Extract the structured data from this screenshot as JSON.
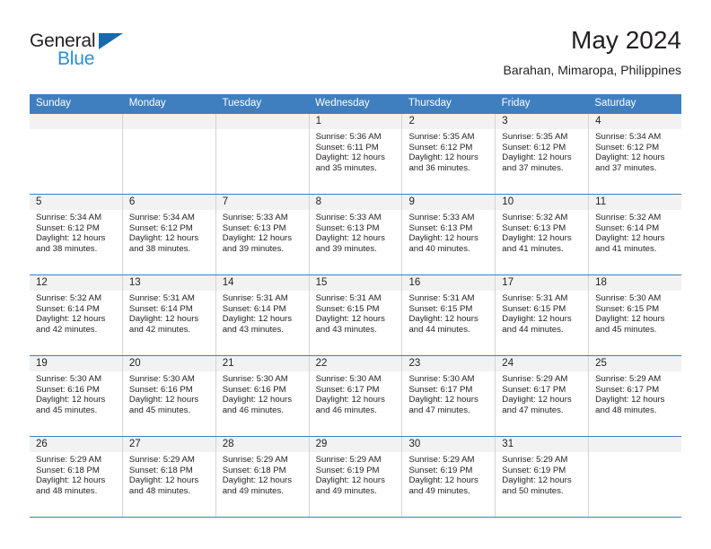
{
  "brand": {
    "line1": "General",
    "line2": "Blue",
    "triangle_color": "#1769b0",
    "line2_color": "#2a8ed6"
  },
  "header": {
    "title": "May 2024",
    "subtitle": "Barahan, Mimaropa, Philippines"
  },
  "theme": {
    "header_blue": "#3f7fbf",
    "cell_band_gray": "#f2f2f2",
    "grid_line": "#d4d4d4",
    "text": "#231f20"
  },
  "weekdays": [
    "Sunday",
    "Monday",
    "Tuesday",
    "Wednesday",
    "Thursday",
    "Friday",
    "Saturday"
  ],
  "weeks": [
    [
      {
        "day": "",
        "sunrise": "",
        "sunset": "",
        "daylight1": "",
        "daylight2": ""
      },
      {
        "day": "",
        "sunrise": "",
        "sunset": "",
        "daylight1": "",
        "daylight2": ""
      },
      {
        "day": "",
        "sunrise": "",
        "sunset": "",
        "daylight1": "",
        "daylight2": ""
      },
      {
        "day": "1",
        "sunrise": "Sunrise: 5:36 AM",
        "sunset": "Sunset: 6:11 PM",
        "daylight1": "Daylight: 12 hours",
        "daylight2": "and 35 minutes."
      },
      {
        "day": "2",
        "sunrise": "Sunrise: 5:35 AM",
        "sunset": "Sunset: 6:12 PM",
        "daylight1": "Daylight: 12 hours",
        "daylight2": "and 36 minutes."
      },
      {
        "day": "3",
        "sunrise": "Sunrise: 5:35 AM",
        "sunset": "Sunset: 6:12 PM",
        "daylight1": "Daylight: 12 hours",
        "daylight2": "and 37 minutes."
      },
      {
        "day": "4",
        "sunrise": "Sunrise: 5:34 AM",
        "sunset": "Sunset: 6:12 PM",
        "daylight1": "Daylight: 12 hours",
        "daylight2": "and 37 minutes."
      }
    ],
    [
      {
        "day": "5",
        "sunrise": "Sunrise: 5:34 AM",
        "sunset": "Sunset: 6:12 PM",
        "daylight1": "Daylight: 12 hours",
        "daylight2": "and 38 minutes."
      },
      {
        "day": "6",
        "sunrise": "Sunrise: 5:34 AM",
        "sunset": "Sunset: 6:12 PM",
        "daylight1": "Daylight: 12 hours",
        "daylight2": "and 38 minutes."
      },
      {
        "day": "7",
        "sunrise": "Sunrise: 5:33 AM",
        "sunset": "Sunset: 6:13 PM",
        "daylight1": "Daylight: 12 hours",
        "daylight2": "and 39 minutes."
      },
      {
        "day": "8",
        "sunrise": "Sunrise: 5:33 AM",
        "sunset": "Sunset: 6:13 PM",
        "daylight1": "Daylight: 12 hours",
        "daylight2": "and 39 minutes."
      },
      {
        "day": "9",
        "sunrise": "Sunrise: 5:33 AM",
        "sunset": "Sunset: 6:13 PM",
        "daylight1": "Daylight: 12 hours",
        "daylight2": "and 40 minutes."
      },
      {
        "day": "10",
        "sunrise": "Sunrise: 5:32 AM",
        "sunset": "Sunset: 6:13 PM",
        "daylight1": "Daylight: 12 hours",
        "daylight2": "and 41 minutes."
      },
      {
        "day": "11",
        "sunrise": "Sunrise: 5:32 AM",
        "sunset": "Sunset: 6:14 PM",
        "daylight1": "Daylight: 12 hours",
        "daylight2": "and 41 minutes."
      }
    ],
    [
      {
        "day": "12",
        "sunrise": "Sunrise: 5:32 AM",
        "sunset": "Sunset: 6:14 PM",
        "daylight1": "Daylight: 12 hours",
        "daylight2": "and 42 minutes."
      },
      {
        "day": "13",
        "sunrise": "Sunrise: 5:31 AM",
        "sunset": "Sunset: 6:14 PM",
        "daylight1": "Daylight: 12 hours",
        "daylight2": "and 42 minutes."
      },
      {
        "day": "14",
        "sunrise": "Sunrise: 5:31 AM",
        "sunset": "Sunset: 6:14 PM",
        "daylight1": "Daylight: 12 hours",
        "daylight2": "and 43 minutes."
      },
      {
        "day": "15",
        "sunrise": "Sunrise: 5:31 AM",
        "sunset": "Sunset: 6:15 PM",
        "daylight1": "Daylight: 12 hours",
        "daylight2": "and 43 minutes."
      },
      {
        "day": "16",
        "sunrise": "Sunrise: 5:31 AM",
        "sunset": "Sunset: 6:15 PM",
        "daylight1": "Daylight: 12 hours",
        "daylight2": "and 44 minutes."
      },
      {
        "day": "17",
        "sunrise": "Sunrise: 5:31 AM",
        "sunset": "Sunset: 6:15 PM",
        "daylight1": "Daylight: 12 hours",
        "daylight2": "and 44 minutes."
      },
      {
        "day": "18",
        "sunrise": "Sunrise: 5:30 AM",
        "sunset": "Sunset: 6:15 PM",
        "daylight1": "Daylight: 12 hours",
        "daylight2": "and 45 minutes."
      }
    ],
    [
      {
        "day": "19",
        "sunrise": "Sunrise: 5:30 AM",
        "sunset": "Sunset: 6:16 PM",
        "daylight1": "Daylight: 12 hours",
        "daylight2": "and 45 minutes."
      },
      {
        "day": "20",
        "sunrise": "Sunrise: 5:30 AM",
        "sunset": "Sunset: 6:16 PM",
        "daylight1": "Daylight: 12 hours",
        "daylight2": "and 45 minutes."
      },
      {
        "day": "21",
        "sunrise": "Sunrise: 5:30 AM",
        "sunset": "Sunset: 6:16 PM",
        "daylight1": "Daylight: 12 hours",
        "daylight2": "and 46 minutes."
      },
      {
        "day": "22",
        "sunrise": "Sunrise: 5:30 AM",
        "sunset": "Sunset: 6:17 PM",
        "daylight1": "Daylight: 12 hours",
        "daylight2": "and 46 minutes."
      },
      {
        "day": "23",
        "sunrise": "Sunrise: 5:30 AM",
        "sunset": "Sunset: 6:17 PM",
        "daylight1": "Daylight: 12 hours",
        "daylight2": "and 47 minutes."
      },
      {
        "day": "24",
        "sunrise": "Sunrise: 5:29 AM",
        "sunset": "Sunset: 6:17 PM",
        "daylight1": "Daylight: 12 hours",
        "daylight2": "and 47 minutes."
      },
      {
        "day": "25",
        "sunrise": "Sunrise: 5:29 AM",
        "sunset": "Sunset: 6:17 PM",
        "daylight1": "Daylight: 12 hours",
        "daylight2": "and 48 minutes."
      }
    ],
    [
      {
        "day": "26",
        "sunrise": "Sunrise: 5:29 AM",
        "sunset": "Sunset: 6:18 PM",
        "daylight1": "Daylight: 12 hours",
        "daylight2": "and 48 minutes."
      },
      {
        "day": "27",
        "sunrise": "Sunrise: 5:29 AM",
        "sunset": "Sunset: 6:18 PM",
        "daylight1": "Daylight: 12 hours",
        "daylight2": "and 48 minutes."
      },
      {
        "day": "28",
        "sunrise": "Sunrise: 5:29 AM",
        "sunset": "Sunset: 6:18 PM",
        "daylight1": "Daylight: 12 hours",
        "daylight2": "and 49 minutes."
      },
      {
        "day": "29",
        "sunrise": "Sunrise: 5:29 AM",
        "sunset": "Sunset: 6:19 PM",
        "daylight1": "Daylight: 12 hours",
        "daylight2": "and 49 minutes."
      },
      {
        "day": "30",
        "sunrise": "Sunrise: 5:29 AM",
        "sunset": "Sunset: 6:19 PM",
        "daylight1": "Daylight: 12 hours",
        "daylight2": "and 49 minutes."
      },
      {
        "day": "31",
        "sunrise": "Sunrise: 5:29 AM",
        "sunset": "Sunset: 6:19 PM",
        "daylight1": "Daylight: 12 hours",
        "daylight2": "and 50 minutes."
      },
      {
        "day": "",
        "sunrise": "",
        "sunset": "",
        "daylight1": "",
        "daylight2": ""
      }
    ]
  ]
}
